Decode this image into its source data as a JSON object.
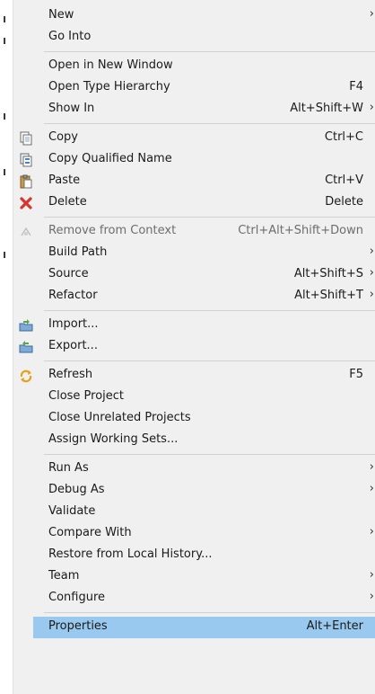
{
  "menu": {
    "groups": [
      [
        {
          "label": "New",
          "accel": "",
          "submenu": true,
          "icon": ""
        },
        {
          "label": "Go Into",
          "accel": "",
          "submenu": false,
          "icon": ""
        }
      ],
      [
        {
          "label": "Open in New Window",
          "accel": "",
          "submenu": false,
          "icon": ""
        },
        {
          "label": "Open Type Hierarchy",
          "accel": "F4",
          "submenu": false,
          "icon": ""
        },
        {
          "label": "Show In",
          "accel": "Alt+Shift+W",
          "submenu": true,
          "icon": ""
        }
      ],
      [
        {
          "label": "Copy",
          "accel": "Ctrl+C",
          "submenu": false,
          "icon": "copy-icon"
        },
        {
          "label": "Copy Qualified Name",
          "accel": "",
          "submenu": false,
          "icon": "copy-qualified-name-icon"
        },
        {
          "label": "Paste",
          "accel": "Ctrl+V",
          "submenu": false,
          "icon": "paste-icon"
        },
        {
          "label": "Delete",
          "accel": "Delete",
          "submenu": false,
          "icon": "delete-icon"
        }
      ],
      [
        {
          "label": "Remove from Context",
          "accel": "Ctrl+Alt+Shift+Down",
          "submenu": false,
          "icon": "remove-context-icon",
          "disabled": true
        },
        {
          "label": "Build Path",
          "accel": "",
          "submenu": true,
          "icon": ""
        },
        {
          "label": "Source",
          "accel": "Alt+Shift+S",
          "submenu": true,
          "icon": ""
        },
        {
          "label": "Refactor",
          "accel": "Alt+Shift+T",
          "submenu": true,
          "icon": ""
        }
      ],
      [
        {
          "label": "Import...",
          "accel": "",
          "submenu": false,
          "icon": "import-icon"
        },
        {
          "label": "Export...",
          "accel": "",
          "submenu": false,
          "icon": "export-icon"
        }
      ],
      [
        {
          "label": "Refresh",
          "accel": "F5",
          "submenu": false,
          "icon": "refresh-icon"
        },
        {
          "label": "Close Project",
          "accel": "",
          "submenu": false,
          "icon": ""
        },
        {
          "label": "Close Unrelated Projects",
          "accel": "",
          "submenu": false,
          "icon": ""
        },
        {
          "label": "Assign Working Sets...",
          "accel": "",
          "submenu": false,
          "icon": ""
        }
      ],
      [
        {
          "label": "Run As",
          "accel": "",
          "submenu": true,
          "icon": ""
        },
        {
          "label": "Debug As",
          "accel": "",
          "submenu": true,
          "icon": ""
        },
        {
          "label": "Validate",
          "accel": "",
          "submenu": false,
          "icon": ""
        },
        {
          "label": "Compare With",
          "accel": "",
          "submenu": true,
          "icon": ""
        },
        {
          "label": "Restore from Local History...",
          "accel": "",
          "submenu": false,
          "icon": ""
        },
        {
          "label": "Team",
          "accel": "",
          "submenu": true,
          "icon": ""
        },
        {
          "label": "Configure",
          "accel": "",
          "submenu": true,
          "icon": ""
        }
      ],
      [
        {
          "label": "Properties",
          "accel": "Alt+Enter",
          "submenu": false,
          "icon": "",
          "selected": true
        }
      ]
    ],
    "submenu_arrow": "›",
    "colors": {
      "menu_bg": "#f0f0f0",
      "selected_bg": "#99c9ef",
      "separator": "#d0d0d0",
      "disabled_text": "#6d6d6d"
    }
  }
}
